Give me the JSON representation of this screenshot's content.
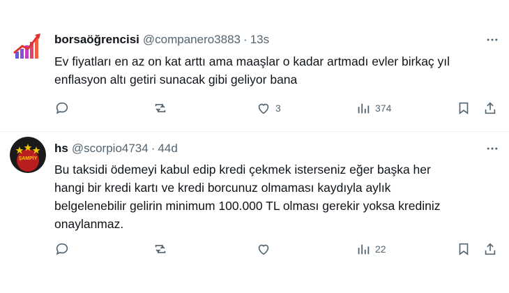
{
  "tweets": [
    {
      "display_name": "borsaöğrencisi",
      "handle": "@companero3883",
      "separator": "·",
      "time": "13s",
      "text_lines": [
        "Ev fiyatları en az on kat arttı ama maaşlar o kadar artmadı evler birkaç yıl",
        "enflasyon altı getiri sunacak gibi geliyor bana"
      ],
      "reply_count": "",
      "retweet_count": "",
      "like_count": "3",
      "view_count": "374",
      "avatar_icon": "rising-chart-icon"
    },
    {
      "display_name": "hs",
      "handle": "@scorpio4734",
      "separator": "·",
      "time": "44d",
      "text_lines": [
        "Bu taksidi ödemeyi kabul edip kredi çekmek isterseniz eğer başka her",
        "hangi bir kredi kartı ve kredi borcunuz olmaması kaydıyla aylık",
        "belgelenebilir gelirin minimum 100.000 TL olması gerekir yoksa krediniz",
        "onaylanmaz."
      ],
      "reply_count": "",
      "retweet_count": "",
      "like_count": "",
      "view_count": "22",
      "avatar_text": "ŞAMPİY"
    }
  ],
  "colors": {
    "text": "#0f1419",
    "muted": "#536471",
    "divider": "#eff3f4"
  }
}
